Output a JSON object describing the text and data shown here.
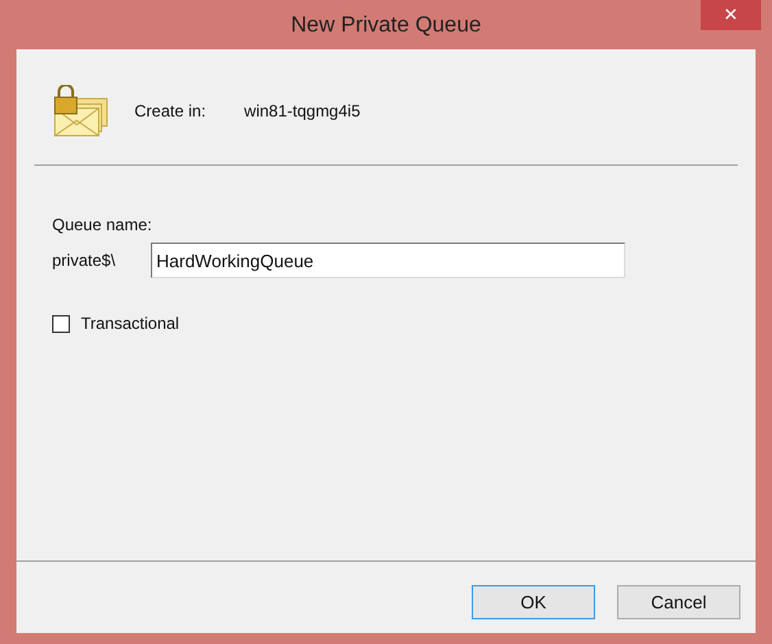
{
  "window": {
    "title": "New Private Queue",
    "close": "✕"
  },
  "header": {
    "label": "Create in:",
    "value": "win81-tqgmg4i5"
  },
  "queue_name": {
    "label": "Queue name:",
    "prefix": "private$\\",
    "value": "HardWorkingQueue"
  },
  "transactional": {
    "label": "Transactional",
    "checked": false
  },
  "buttons": [
    {
      "label": "OK",
      "default": true
    },
    {
      "label": "Cancel",
      "default": false
    }
  ]
}
